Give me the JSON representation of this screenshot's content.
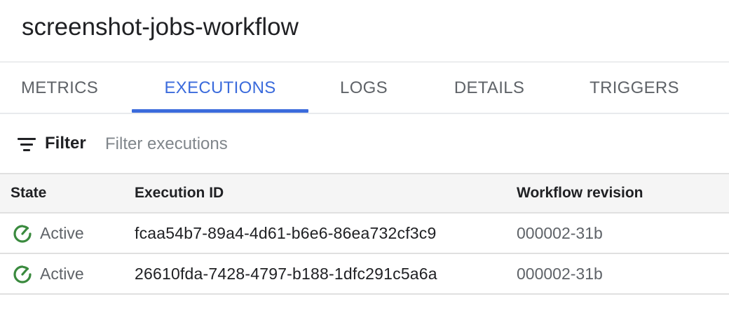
{
  "header": {
    "title": "screenshot-jobs-workflow"
  },
  "tabs": [
    {
      "label": "METRICS",
      "active": false
    },
    {
      "label": "EXECUTIONS",
      "active": true
    },
    {
      "label": "LOGS",
      "active": false
    },
    {
      "label": "DETAILS",
      "active": false
    },
    {
      "label": "TRIGGERS",
      "active": false
    }
  ],
  "filter": {
    "label": "Filter",
    "placeholder": "Filter executions",
    "icon": "filter-list-icon"
  },
  "table": {
    "columns": [
      "State",
      "Execution ID",
      "Workflow revision"
    ],
    "rows": [
      {
        "state": "Active",
        "execution_id": "fcaa54b7-89a4-4d61-b6e6-86ea732cf3c9",
        "revision": "000002-31b",
        "icon": "active-status-icon"
      },
      {
        "state": "Active",
        "execution_id": "26610fda-7428-4797-b188-1dfc291c5a6a",
        "revision": "000002-31b",
        "icon": "active-status-icon"
      }
    ]
  },
  "colors": {
    "accent": "#3b6bdc",
    "active_status": "#3a8a3e",
    "muted_text": "#5f6368"
  }
}
